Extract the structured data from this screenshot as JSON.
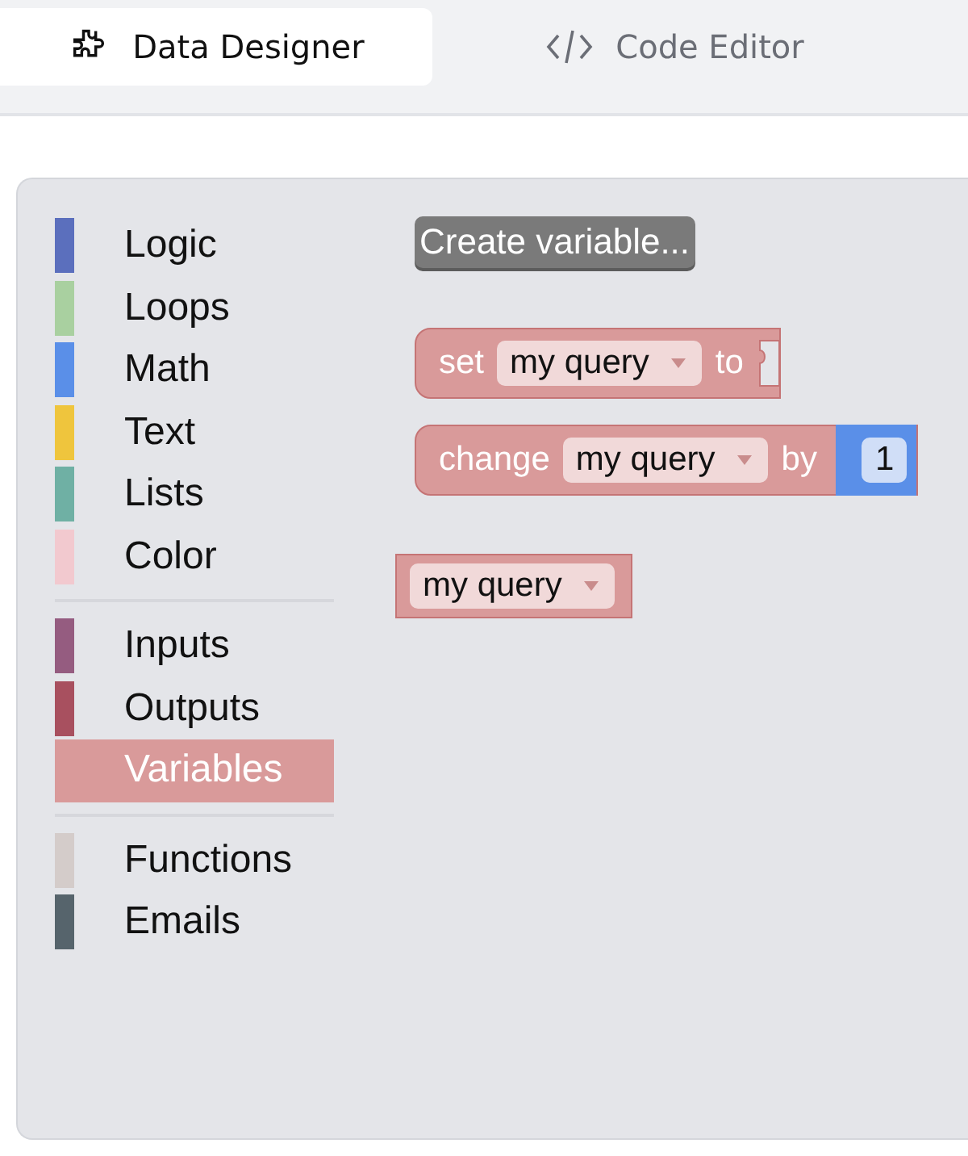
{
  "tabs": [
    {
      "label": "Data Designer",
      "kind": "designer",
      "selected": true
    },
    {
      "label": "Code Editor",
      "kind": "code",
      "selected": false
    }
  ],
  "toolbox": {
    "groups": [
      [
        {
          "label": "Logic",
          "color": "#5b6fbd",
          "selected": false
        },
        {
          "label": "Loops",
          "color": "#a9d0a0",
          "selected": false
        },
        {
          "label": "Math",
          "color": "#5a8fe8",
          "selected": false
        },
        {
          "label": "Text",
          "color": "#efc53d",
          "selected": false
        },
        {
          "label": "Lists",
          "color": "#6fb0a4",
          "selected": false
        },
        {
          "label": "Color",
          "color": "#f2c9cf",
          "selected": false
        }
      ],
      [
        {
          "label": "Inputs",
          "color": "#955c80",
          "selected": false
        },
        {
          "label": "Outputs",
          "color": "#a8505f",
          "selected": false
        },
        {
          "label": "Variables",
          "color": "#d99a9a",
          "selected": true
        }
      ],
      [
        {
          "label": "Functions",
          "color": "#d4ccca",
          "selected": false
        },
        {
          "label": "Emails",
          "color": "#56646c",
          "selected": false
        }
      ]
    ]
  },
  "flyout": {
    "button": "Create variable...",
    "blocks": [
      {
        "kind": "statement",
        "parts": [
          {
            "kind": "label",
            "text": "set"
          },
          {
            "kind": "dropdown",
            "text": "my query"
          },
          {
            "kind": "label",
            "text": "to"
          },
          {
            "kind": "socket"
          }
        ]
      },
      {
        "kind": "statement",
        "parts": [
          {
            "kind": "label",
            "text": "change"
          },
          {
            "kind": "dropdown",
            "text": "my query"
          },
          {
            "kind": "label",
            "text": "by"
          },
          {
            "kind": "number",
            "text": "1"
          }
        ]
      },
      {
        "kind": "value",
        "parts": [
          {
            "kind": "dropdown",
            "text": "my query"
          }
        ]
      }
    ]
  }
}
